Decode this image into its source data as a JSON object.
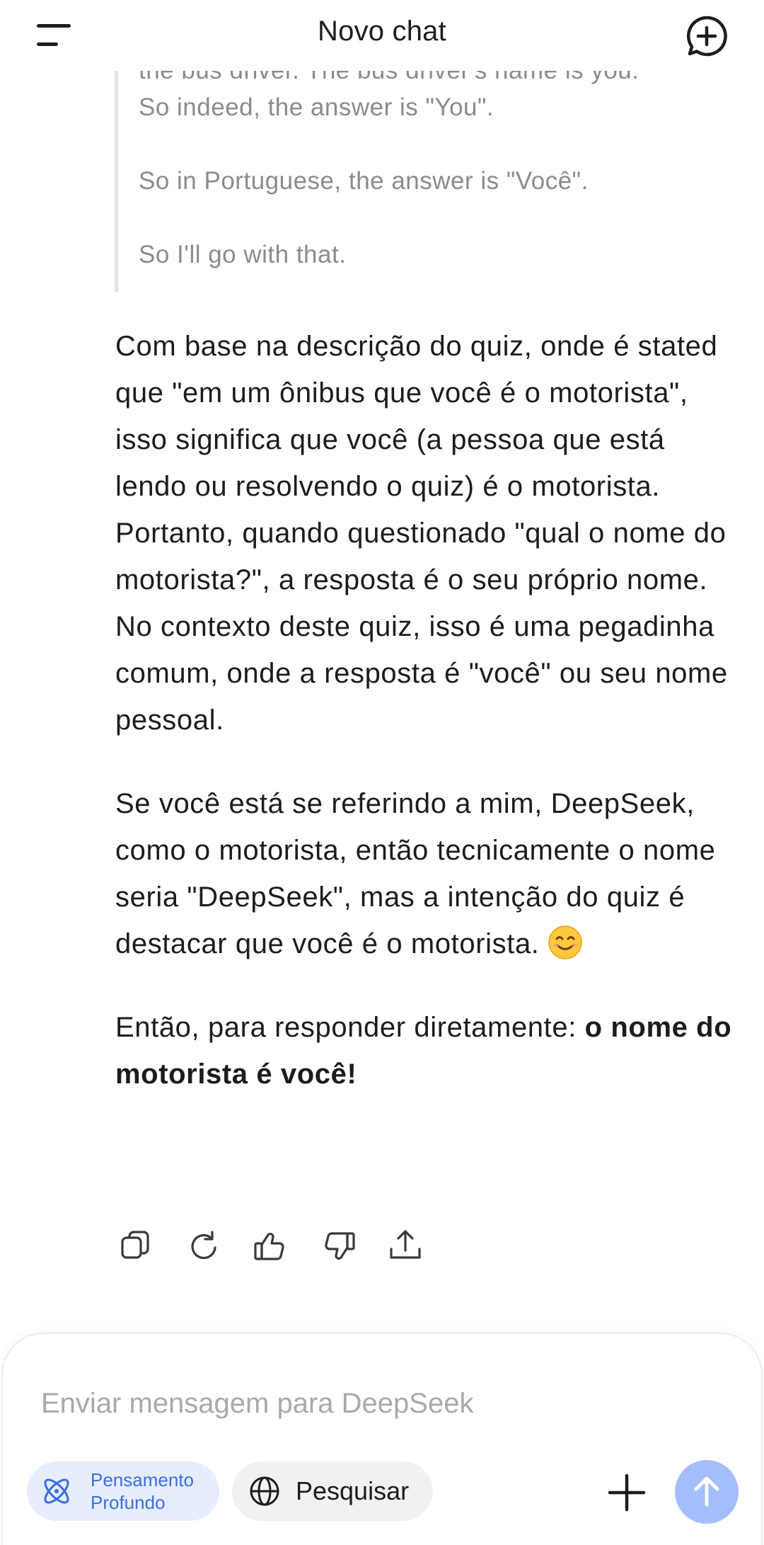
{
  "header": {
    "title": "Novo chat"
  },
  "thinking": {
    "cut_line": "the bus driver. The bus driver's name is you.\"",
    "lines": [
      "So indeed, the answer is \"You\".",
      "So in Portuguese, the answer is \"Você\".",
      "So I'll go with that."
    ]
  },
  "answer": {
    "p1": "Com base na descrição do quiz, onde é stated que \"em um ônibus que você é o motorista\", isso significa que você (a pessoa que está lendo ou resolvendo o quiz) é o motorista. Portanto, quando questionado \"qual o nome do motorista?\", a resposta é o seu próprio nome. No contexto deste quiz, isso é uma pegadinha comum, onde a resposta é \"você\" ou seu nome pessoal.",
    "p2": "Se você está se referindo a mim, DeepSeek, como o motorista, então tecnicamente o nome seria \"DeepSeek\", mas a intenção do quiz é destacar que você é o motorista.",
    "p2_emoji": "smiling-face-emoji",
    "p3_prefix": "Então, para responder diretamente: ",
    "p3_bold": "o nome do motorista é você!"
  },
  "actions": {
    "icons": [
      "copy-icon",
      "regenerate-icon",
      "thumbs-up-icon",
      "thumbs-down-icon",
      "share-icon"
    ]
  },
  "composer": {
    "placeholder": "Enviar mensagem para DeepSeek",
    "deep_think_label": "Pensamento\nProfundo",
    "search_label": "Pesquisar"
  },
  "colors": {
    "accent": "#3d6ee0",
    "deep_think_bg": "#e6eefd",
    "send_button": "#a4bdfb",
    "thinking_text": "#8b8b8b"
  }
}
